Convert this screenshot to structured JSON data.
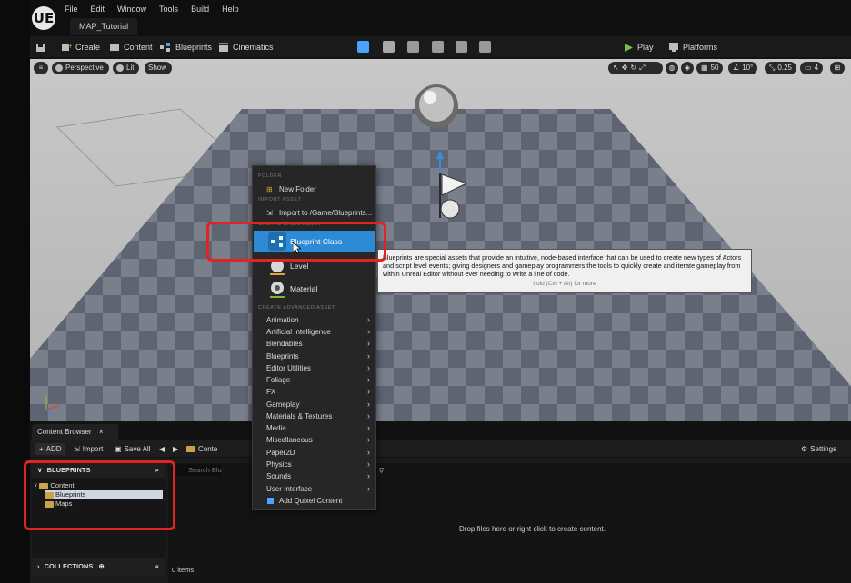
{
  "app": {
    "logo": "UE",
    "menu": [
      "File",
      "Edit",
      "Window",
      "Tools",
      "Build",
      "Help"
    ],
    "map_tab": "MAP_Tutorial"
  },
  "toolbar": {
    "create": "Create",
    "content": "Content",
    "blueprints": "Blueprints",
    "cinematics": "Cinematics",
    "play": "Play",
    "platforms": "Platforms"
  },
  "viewport": {
    "perspective": "Perspective",
    "lit": "Lit",
    "show": "Show",
    "grid_snap": "50",
    "rotation_snap": "10°",
    "scale_snap": "0.25",
    "camera_speed": "4"
  },
  "context_menu": {
    "folder_header": "FOLDER",
    "new_folder": "New Folder",
    "import_header": "IMPORT ASSET",
    "import_to": "Import to /Game/Blueprints...",
    "create_basic_header": "CREATE BASIC ASSET",
    "blueprint_class": "Blueprint Class",
    "level": "Level",
    "material": "Material",
    "create_advanced_header": "CREATE ADVANCED ASSET",
    "advanced_items": [
      "Animation",
      "Artificial Intelligence",
      "Blendables",
      "Blueprints",
      "Editor Utilities",
      "Foliage",
      "FX",
      "Gameplay",
      "Materials & Textures",
      "Media",
      "Miscellaneous",
      "Paper2D",
      "Physics",
      "Sounds",
      "User Interface"
    ],
    "add_quixel": "Add Quixel Content"
  },
  "tooltip": {
    "text": "Blueprints are special assets that provide an intuitive, node-based interface that can be used to create new types of Actors and script level events; giving designers and gameplay programmers the tools to quickly create and iterate gameplay from within Unreal Editor without ever needing to write a line of code.",
    "hint": "hold (Ctrl + Alt) for more"
  },
  "content_browser": {
    "tab": "Content Browser",
    "add": "ADD",
    "import": "Import",
    "save_all": "Save All",
    "path": "Conte",
    "settings": "Settings",
    "blueprints_header": "BLUEPRINTS",
    "tree": [
      "Content",
      "Blueprints",
      "Maps"
    ],
    "collections": "COLLECTIONS",
    "search_placeholder": "Search Blu",
    "drop_hint": "Drop files here or right click to create content.",
    "item_count": "0 items"
  },
  "colors": {
    "accent": "#2d8ad7",
    "highlight_box": "#e02323",
    "play": "#7bc043"
  }
}
